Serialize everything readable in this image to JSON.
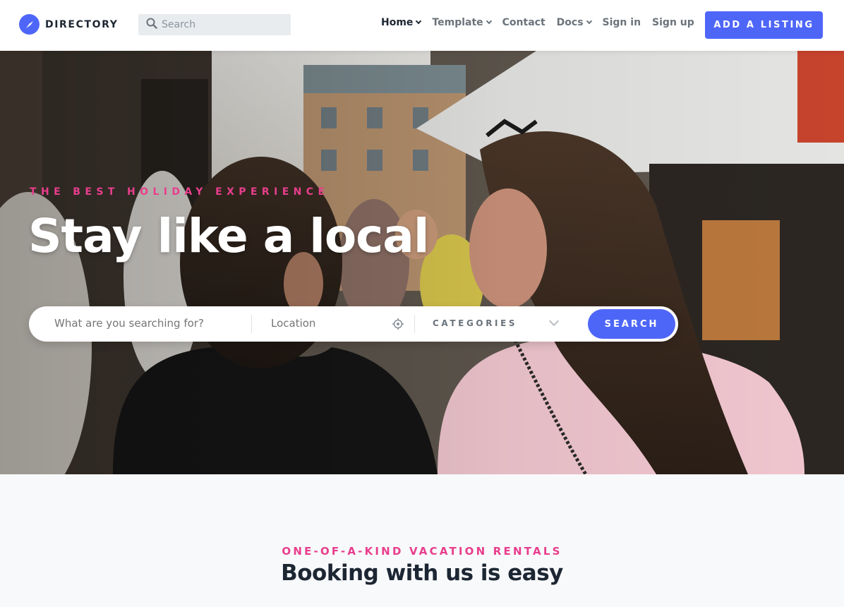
{
  "brand": {
    "name": "DIRECTORY"
  },
  "search": {
    "placeholder": "Search"
  },
  "nav": {
    "links": [
      {
        "label": "Home",
        "dropdown": true,
        "active": true
      },
      {
        "label": "Template",
        "dropdown": true
      },
      {
        "label": "Contact",
        "dropdown": false
      },
      {
        "label": "Docs",
        "dropdown": true
      },
      {
        "label": "Sign in",
        "dropdown": false
      },
      {
        "label": "Sign up",
        "dropdown": false
      }
    ],
    "cta_label": "ADD A LISTING"
  },
  "hero": {
    "subtitle": "THE BEST HOLIDAY EXPERIENCE",
    "title": "Stay like a local",
    "searchbar": {
      "what_placeholder": "What are you searching for?",
      "location_placeholder": "Location",
      "categories_label": "CATEGORIES",
      "button_label": "SEARCH"
    }
  },
  "section": {
    "subtitle": "ONE-OF-A-KIND VACATION RENTALS",
    "title": "Booking with us is easy"
  },
  "colors": {
    "primary": "#4e66f8",
    "accent": "#e83e8c",
    "dark": "#1d2733"
  }
}
